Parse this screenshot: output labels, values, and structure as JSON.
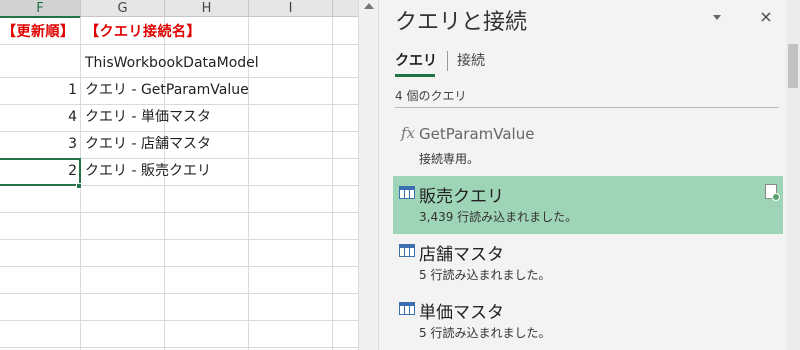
{
  "sheet": {
    "columns": [
      "F",
      "G",
      "H",
      "I"
    ],
    "selected_column": "F",
    "header_row": {
      "f": "【更新順】",
      "g": "【クエリ接続名】"
    },
    "rows": [
      {
        "order": "",
        "name": "ThisWorkbookDataModel"
      },
      {
        "order": "1",
        "name": "クエリ - GetParamValue"
      },
      {
        "order": "4",
        "name": "クエリ - 単価マスタ"
      },
      {
        "order": "3",
        "name": "クエリ - 店舗マスタ"
      },
      {
        "order": "2",
        "name": "クエリ - 販売クエリ"
      }
    ]
  },
  "pane": {
    "title": "クエリと接続",
    "close_label": "×",
    "tabs": [
      {
        "label": "クエリ",
        "active": true
      },
      {
        "label": "接続",
        "active": false
      }
    ],
    "count_text": "4 個のクエリ",
    "queries": [
      {
        "icon": "fx-icon",
        "name": "GetParamValue",
        "status": "接続専用。",
        "selected": false
      },
      {
        "icon": "table-icon",
        "name": "販売クエリ",
        "status": "3,439 行読み込まれました。",
        "selected": true
      },
      {
        "icon": "table-icon",
        "name": "店舗マスタ",
        "status": "5 行読み込まれました。",
        "selected": false
      },
      {
        "icon": "table-icon",
        "name": "単価マスタ",
        "status": "5 行読み込まれました。",
        "selected": false
      }
    ]
  },
  "colors": {
    "accent": "#217346",
    "selection": "#9fd5b7",
    "header_red": "#e00000"
  }
}
